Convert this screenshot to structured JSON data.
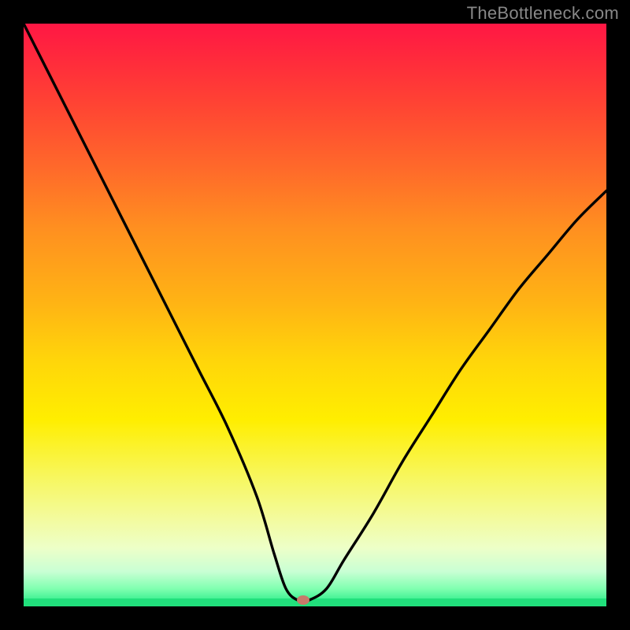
{
  "watermark": {
    "text": "TheBottleneck.com"
  },
  "colors": {
    "page_bg": "#000000",
    "gradient_top": "#ff1744",
    "gradient_bottom": "#17e880",
    "curve": "#000000",
    "marker": "#c77a6a"
  },
  "chart_data": {
    "type": "line",
    "title": "",
    "xlabel": "",
    "ylabel": "",
    "xlim": [
      0,
      1
    ],
    "ylim": [
      0,
      1
    ],
    "x": [
      0.0,
      0.02,
      0.05,
      0.1,
      0.15,
      0.2,
      0.25,
      0.3,
      0.35,
      0.4,
      0.43,
      0.45,
      0.47,
      0.49,
      0.52,
      0.55,
      0.6,
      0.65,
      0.7,
      0.75,
      0.8,
      0.85,
      0.9,
      0.95,
      1.0
    ],
    "series": [
      {
        "name": "curve",
        "values": [
          1.0,
          0.96,
          0.9,
          0.8,
          0.7,
          0.6,
          0.5,
          0.4,
          0.3,
          0.18,
          0.08,
          0.02,
          0.0,
          0.0,
          0.02,
          0.07,
          0.15,
          0.24,
          0.32,
          0.4,
          0.47,
          0.54,
          0.6,
          0.66,
          0.71
        ]
      }
    ],
    "marker": {
      "x": 0.48,
      "y": 0.0
    },
    "background_gradient": {
      "orientation": "vertical",
      "stops": [
        {
          "pos": 0.0,
          "color": "#ff1744"
        },
        {
          "pos": 0.25,
          "color": "#ff6a2a"
        },
        {
          "pos": 0.5,
          "color": "#ffb414"
        },
        {
          "pos": 0.68,
          "color": "#ffee00"
        },
        {
          "pos": 0.9,
          "color": "#edffc8"
        },
        {
          "pos": 1.0,
          "color": "#17e880"
        }
      ]
    }
  }
}
